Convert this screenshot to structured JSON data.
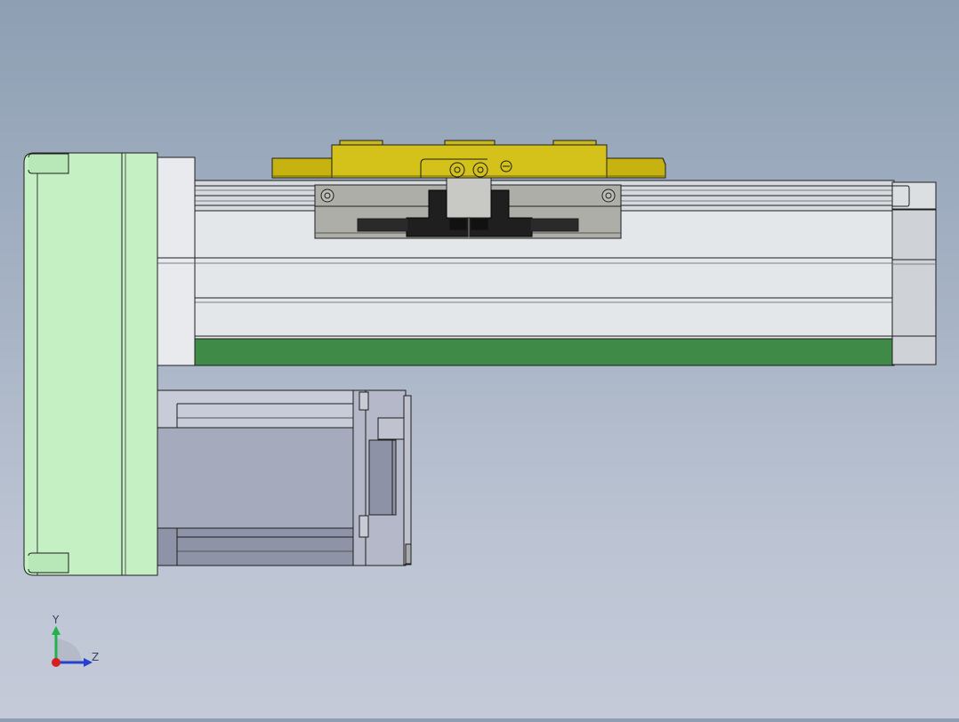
{
  "viewport": {
    "background_top": "#8e9fb3",
    "background_bottom": "#c4cad8",
    "colors": {
      "motor_flange": "#c4f0c4",
      "carriage_top": "#d4c21a",
      "rail_body": "#e4e7ea",
      "green_strip": "#3e8a46",
      "motor_body": "#a6aabd",
      "edge": "#1e1e1e"
    }
  },
  "triad": {
    "y_label": "Y",
    "z_label": "Z",
    "y_color": "#21b24b",
    "z_color": "#2340d0",
    "x_color": "#d42020"
  }
}
